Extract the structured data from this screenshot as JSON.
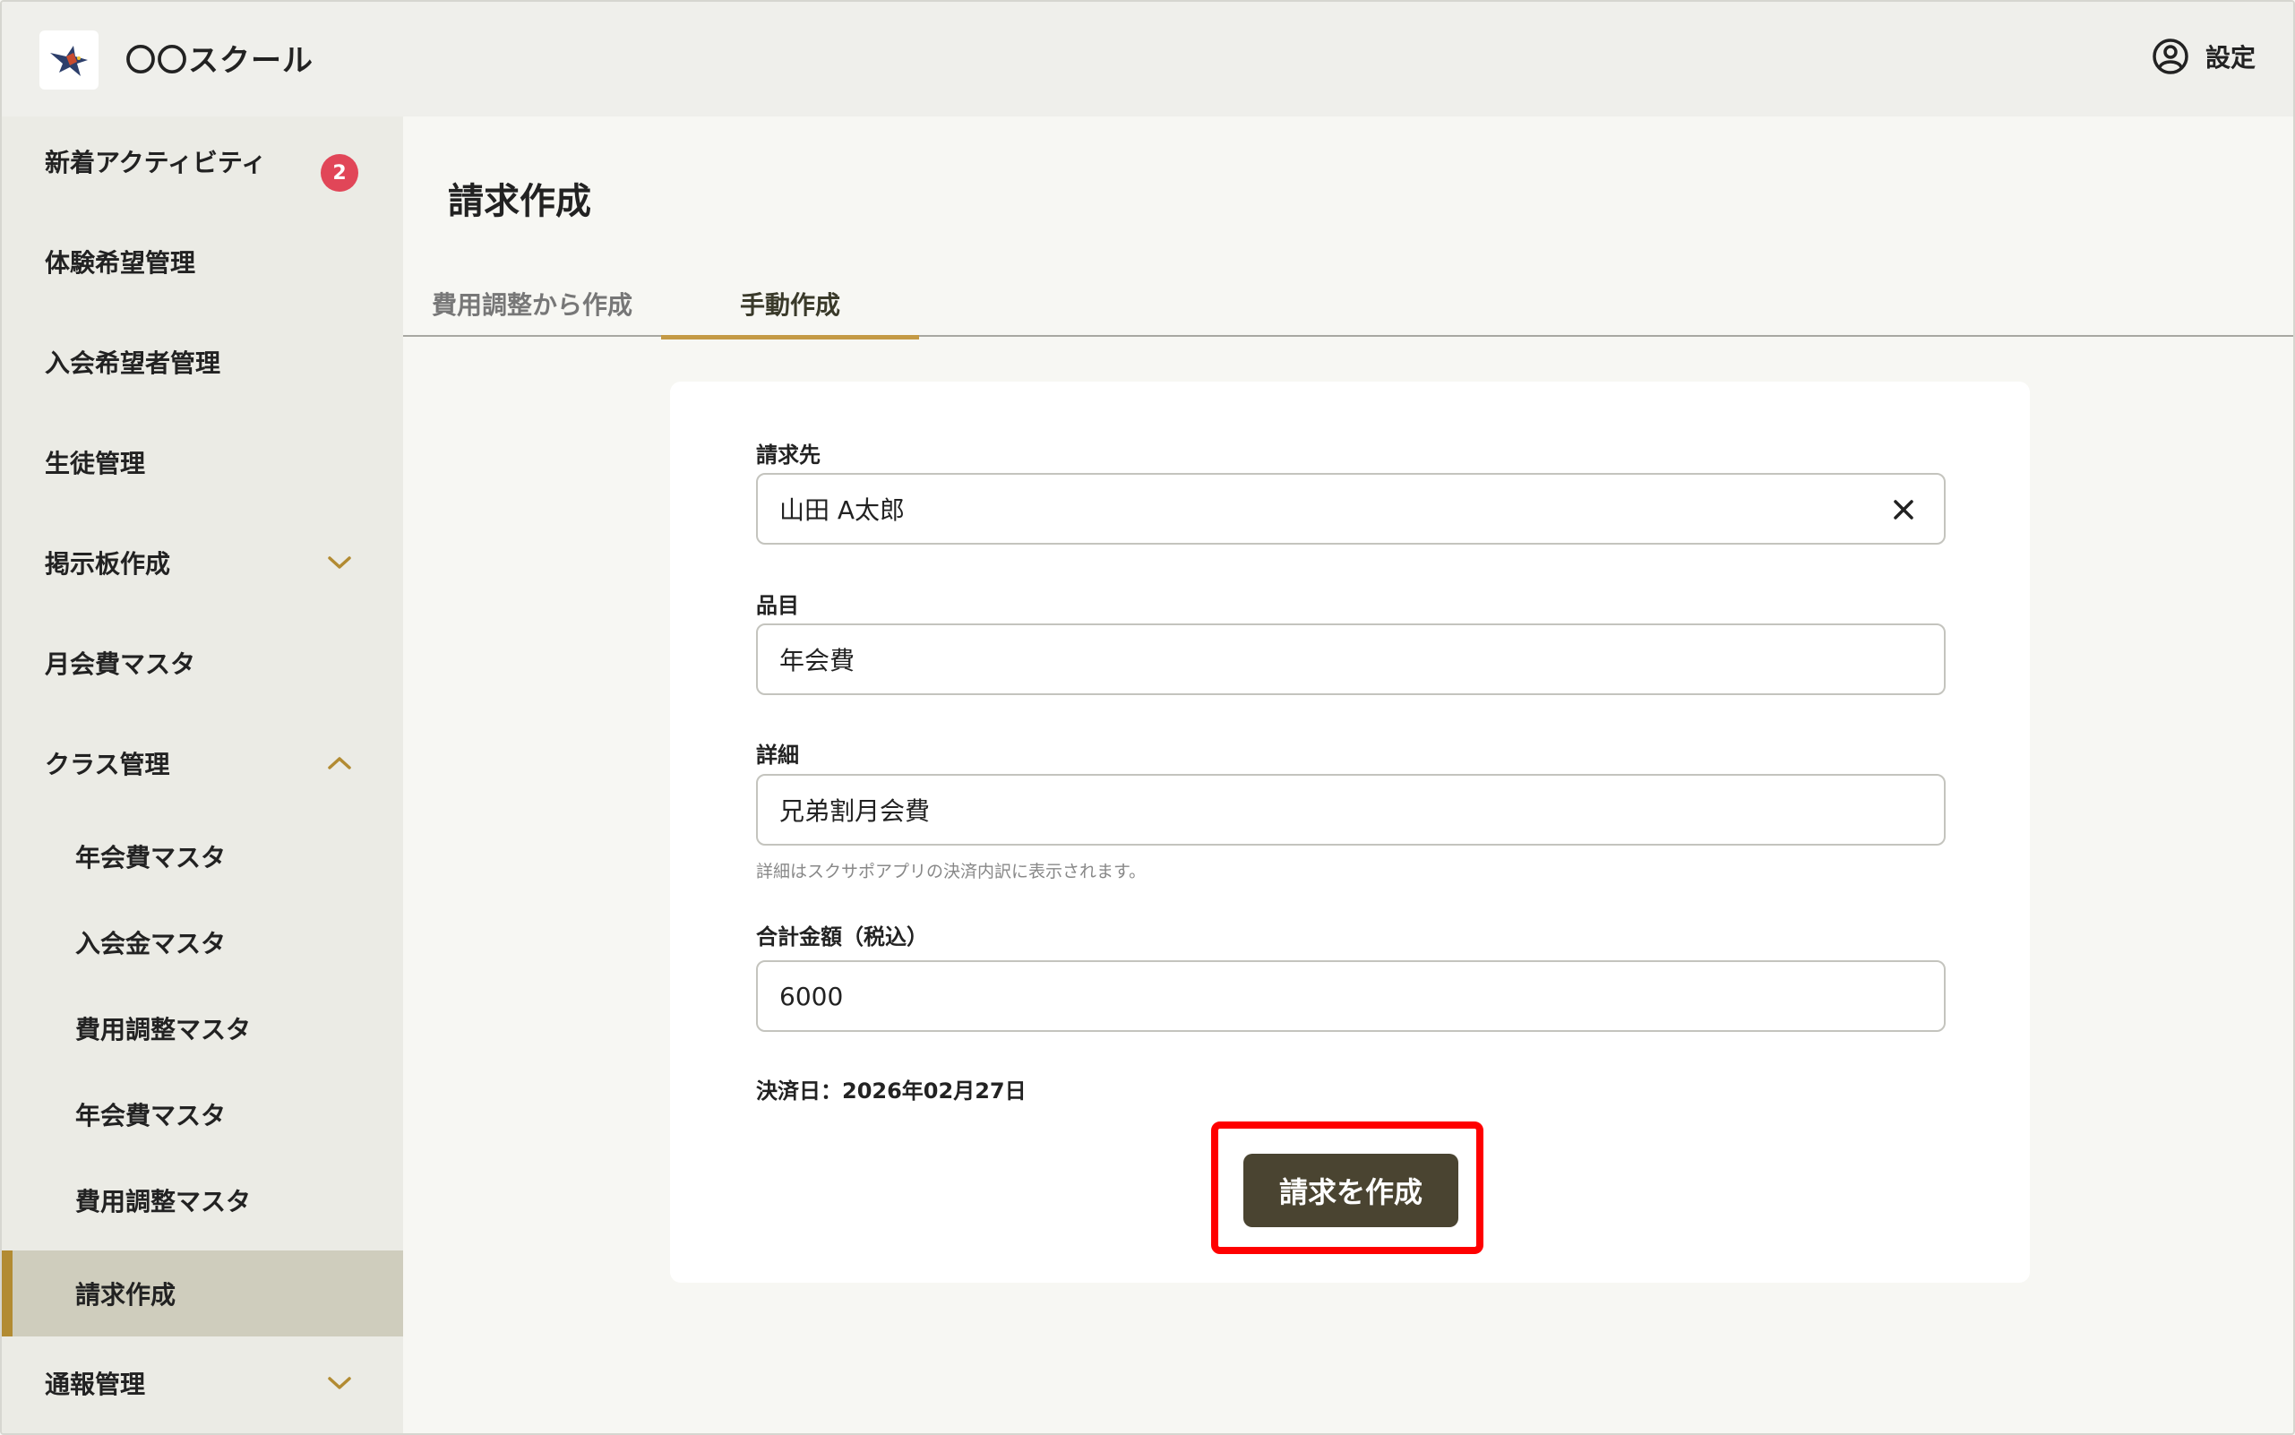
{
  "header": {
    "app_title": "〇〇スクール",
    "settings_label": "設定"
  },
  "sidebar": {
    "items": [
      {
        "label": "新着アクティビティ",
        "badge": "2"
      },
      {
        "label": "体験希望管理"
      },
      {
        "label": "入会希望者管理"
      },
      {
        "label": "生徒管理"
      },
      {
        "label": "掲示板作成",
        "chevron": "chevron-down"
      },
      {
        "label": "月会費マスタ"
      },
      {
        "label": "クラス管理",
        "chevron": "chevron-up"
      },
      {
        "label": "年会費マスタ"
      },
      {
        "label": "入会金マスタ"
      },
      {
        "label": "費用調整マスタ"
      },
      {
        "label": "年会費マスタ"
      },
      {
        "label": "費用調整マスタ"
      },
      {
        "label": "請求作成",
        "active": true
      },
      {
        "label": "通報管理",
        "chevron": "chevron-down"
      }
    ]
  },
  "main": {
    "page_title": "請求作成",
    "tabs": [
      {
        "label": "費用調整から作成"
      },
      {
        "label": "手動作成",
        "active": true
      }
    ],
    "form": {
      "recipient_label": "請求先",
      "recipient_value": "山田 A太郎",
      "item_label": "品目",
      "item_value": "年会費",
      "detail_label": "詳細",
      "detail_value": "兄弟割月会費",
      "detail_hint": "詳細はスクサポアプリの決済内訳に表示されます。",
      "amount_label": "合計金額（税込）",
      "amount_value": "6000",
      "pay_date": "決済日：2026年02月27日",
      "submit_label": "請求を作成"
    }
  },
  "colors": {
    "accent": "#c49a45",
    "badge": "#e14658",
    "button": "#4a4431",
    "highlight": "#ff0000"
  }
}
